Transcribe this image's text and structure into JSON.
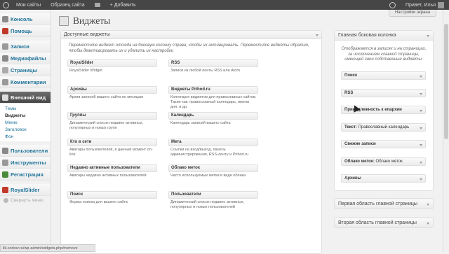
{
  "adminbar": {
    "my_sites": "Мои сайты",
    "site_name": "Образец сайта",
    "add_label": "+ Добавить",
    "greeting": "Привет, Илья"
  },
  "screen_options": "Настройки экрана",
  "page_title": "Виджеты",
  "menu": {
    "items": [
      {
        "label": "Консоль",
        "icon": "dashboard-icon",
        "color": "#8a8a8a"
      },
      {
        "label": "Помощь",
        "icon": "help-icon",
        "color": "#c0392b"
      }
    ],
    "items2": [
      {
        "label": "Записи",
        "icon": "pin-icon",
        "color": "#999"
      },
      {
        "label": "Медиафайлы",
        "icon": "media-icon",
        "color": "#888"
      },
      {
        "label": "Страницы",
        "icon": "pages-icon",
        "color": "#aaa"
      },
      {
        "label": "Комментарии",
        "icon": "comments-icon",
        "color": "#999"
      }
    ],
    "appearance": {
      "label": "Внешний вид",
      "icon": "appearance-icon",
      "color": "#ddd"
    },
    "submenu": [
      "Темы",
      "Виджеты",
      "Меню",
      "Заголовок",
      "Фон"
    ],
    "items3": [
      {
        "label": "Пользователи",
        "icon": "users-icon",
        "color": "#888"
      },
      {
        "label": "Инструменты",
        "icon": "tools-icon",
        "color": "#999"
      },
      {
        "label": "Регистрация",
        "icon": "registration-icon",
        "color": "#4a8a3a"
      }
    ],
    "royalslider": {
      "label": "RoyalSlider",
      "icon": "royalslider-icon",
      "color": "#c0392b"
    },
    "collapse": "Свернуть меню"
  },
  "available": {
    "title": "Доступные виджеты",
    "desc": "Переместите виджет отсюда на боковую колонку справа, чтобы их активировать. Переместите виджеты обратно, чтобы деактивировать их и удалить их настройки",
    "widgets": [
      [
        {
          "title": "RoyalSlider",
          "desc": "RoyalSlider Widget"
        },
        {
          "title": "RSS",
          "desc": "Записи из любой ленты RSS или Atom"
        }
      ],
      [
        {
          "title": "Архивы",
          "desc": "Архив записей вашего сайта по месяцам"
        },
        {
          "title": "Виджеты Prihod.ru",
          "desc": "Коллекция виджетов для православных сайтов. Такие как: православный календарь, имена дня, и др."
        }
      ],
      [
        {
          "title": "Группы",
          "desc": "Динамический список недавно активных, популярных и новых групп"
        },
        {
          "title": "Календарь",
          "desc": "Календарь записей вашего сайта"
        }
      ],
      [
        {
          "title": "Кто в сети",
          "desc": "Аватары пользователей, в данный момент on-line"
        },
        {
          "title": "Мета",
          "desc": "Ссылки на вход/выход, панель администрирования, RSS-ленту и Prihod.ru"
        }
      ],
      [
        {
          "title": "Недавно активные пользователи",
          "desc": "Аватары недавно активных пользователей"
        },
        {
          "title": "Облако меток",
          "desc": "Часто используемые метки в виде облака"
        }
      ],
      [
        {
          "title": "Поиск",
          "desc": "Форма поиска для вашего сайта"
        },
        {
          "title": "Пользователи",
          "desc": "Динамический список недавно активных, популярных и новых пользователей"
        }
      ]
    ]
  },
  "main_sidebar": {
    "title": "Главная боковая колонка",
    "desc": "Отображается в записях и на страницах, за исключением главной страницы, имеющей свои собственные виджеты.",
    "widgets": [
      {
        "title": "Поиск",
        "name": ""
      },
      {
        "title": "RSS",
        "name": ""
      },
      {
        "title": "Принадлежность к епархии",
        "name": ""
      },
      {
        "title": "Текст:",
        "name": "Православный календарь"
      },
      {
        "title": "Свежие записи",
        "name": ""
      },
      {
        "title": "Облако меток:",
        "name": "Облако меток"
      },
      {
        "title": "Архивы",
        "name": ""
      }
    ]
  },
  "area_first": "Первая область главной страницы",
  "area_second": "Вторая область главной страницы",
  "status_url": "ilk.corkov.ru/wp-admin/widgets.php#remove"
}
